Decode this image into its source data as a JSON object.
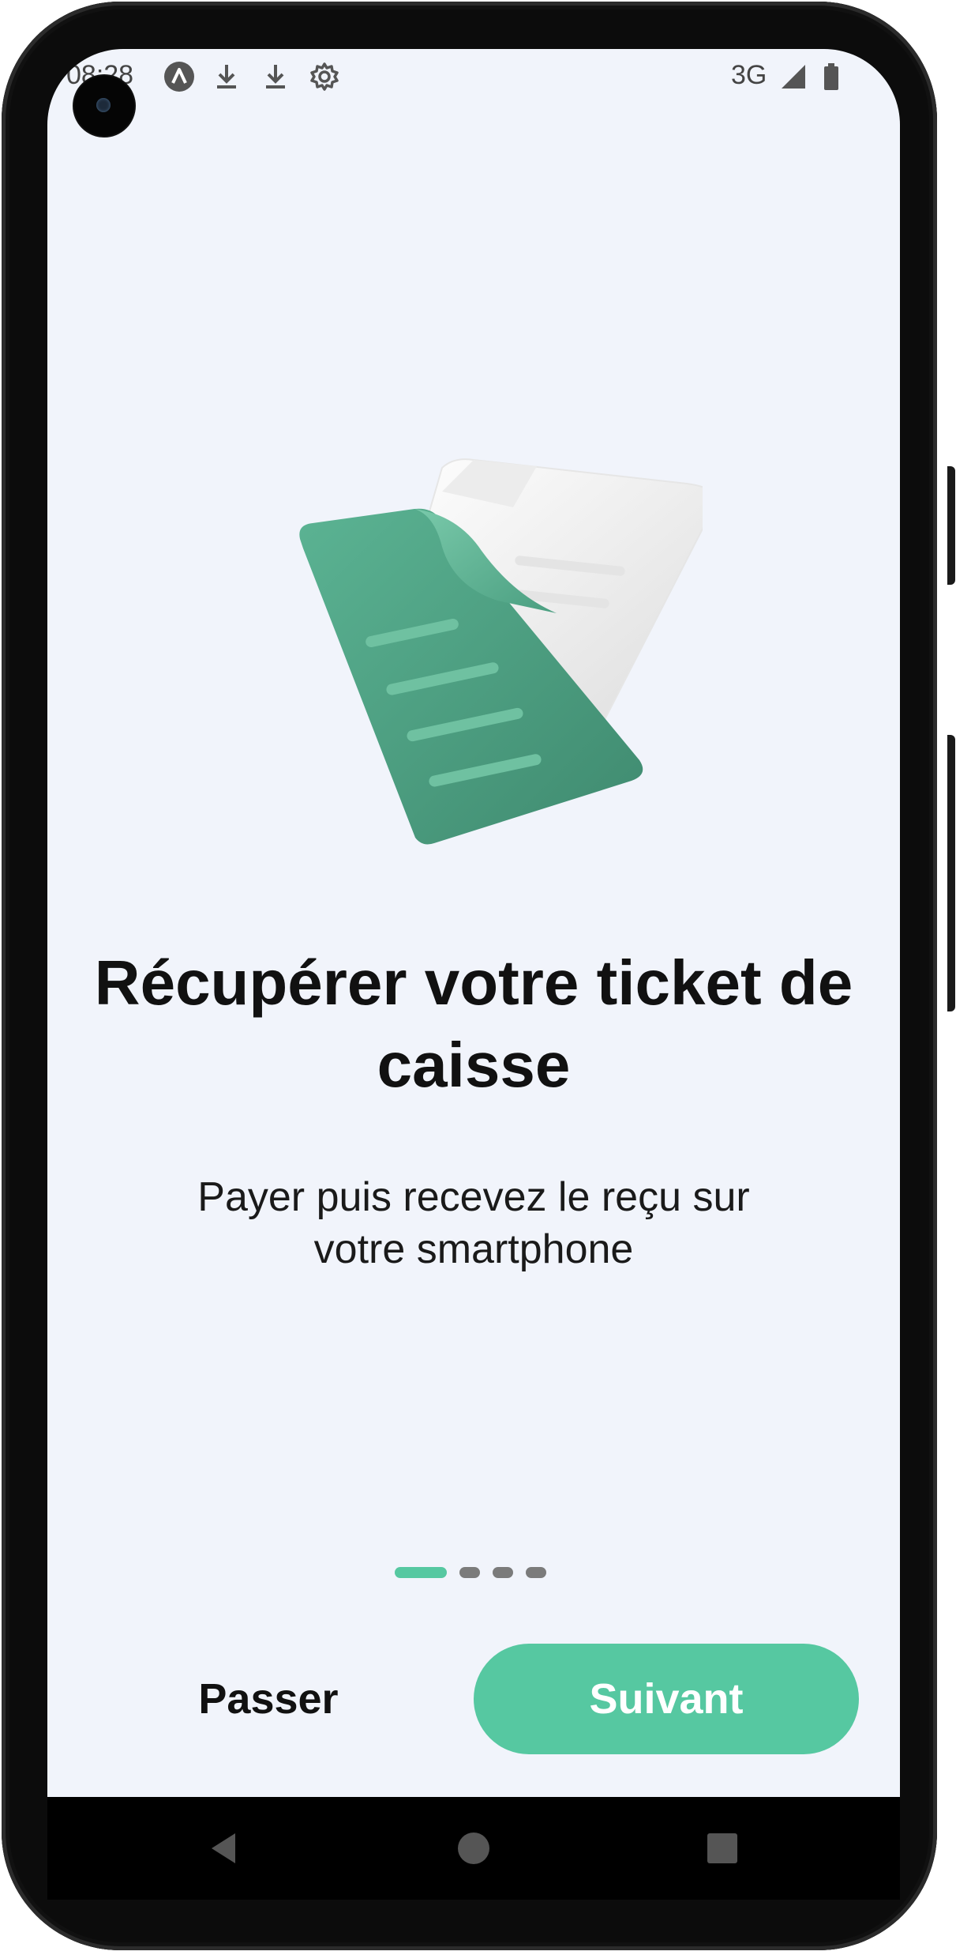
{
  "status_bar": {
    "time": "08:28",
    "network": "3G",
    "icons": [
      "app-a-icon",
      "download-icon",
      "download-icon",
      "settings-gear-icon",
      "signal-icon",
      "battery-icon"
    ]
  },
  "onboarding": {
    "illustration": "receipt-documents-illustration",
    "title": "Récupérer votre ticket de caisse",
    "subtitle": "Payer puis recevez le reçu sur votre smartphone",
    "pages": 4,
    "current_page": 1
  },
  "actions": {
    "skip_label": "Passer",
    "next_label": "Suivant"
  },
  "navigation_bar": {
    "icons": [
      "back-triangle-icon",
      "home-circle-icon",
      "recents-square-icon"
    ]
  },
  "colors": {
    "accent": "#56c8a1",
    "background": "#f1f4fb",
    "illustration_green": "#4a9e80",
    "dot_inactive": "#7b7b7b"
  }
}
